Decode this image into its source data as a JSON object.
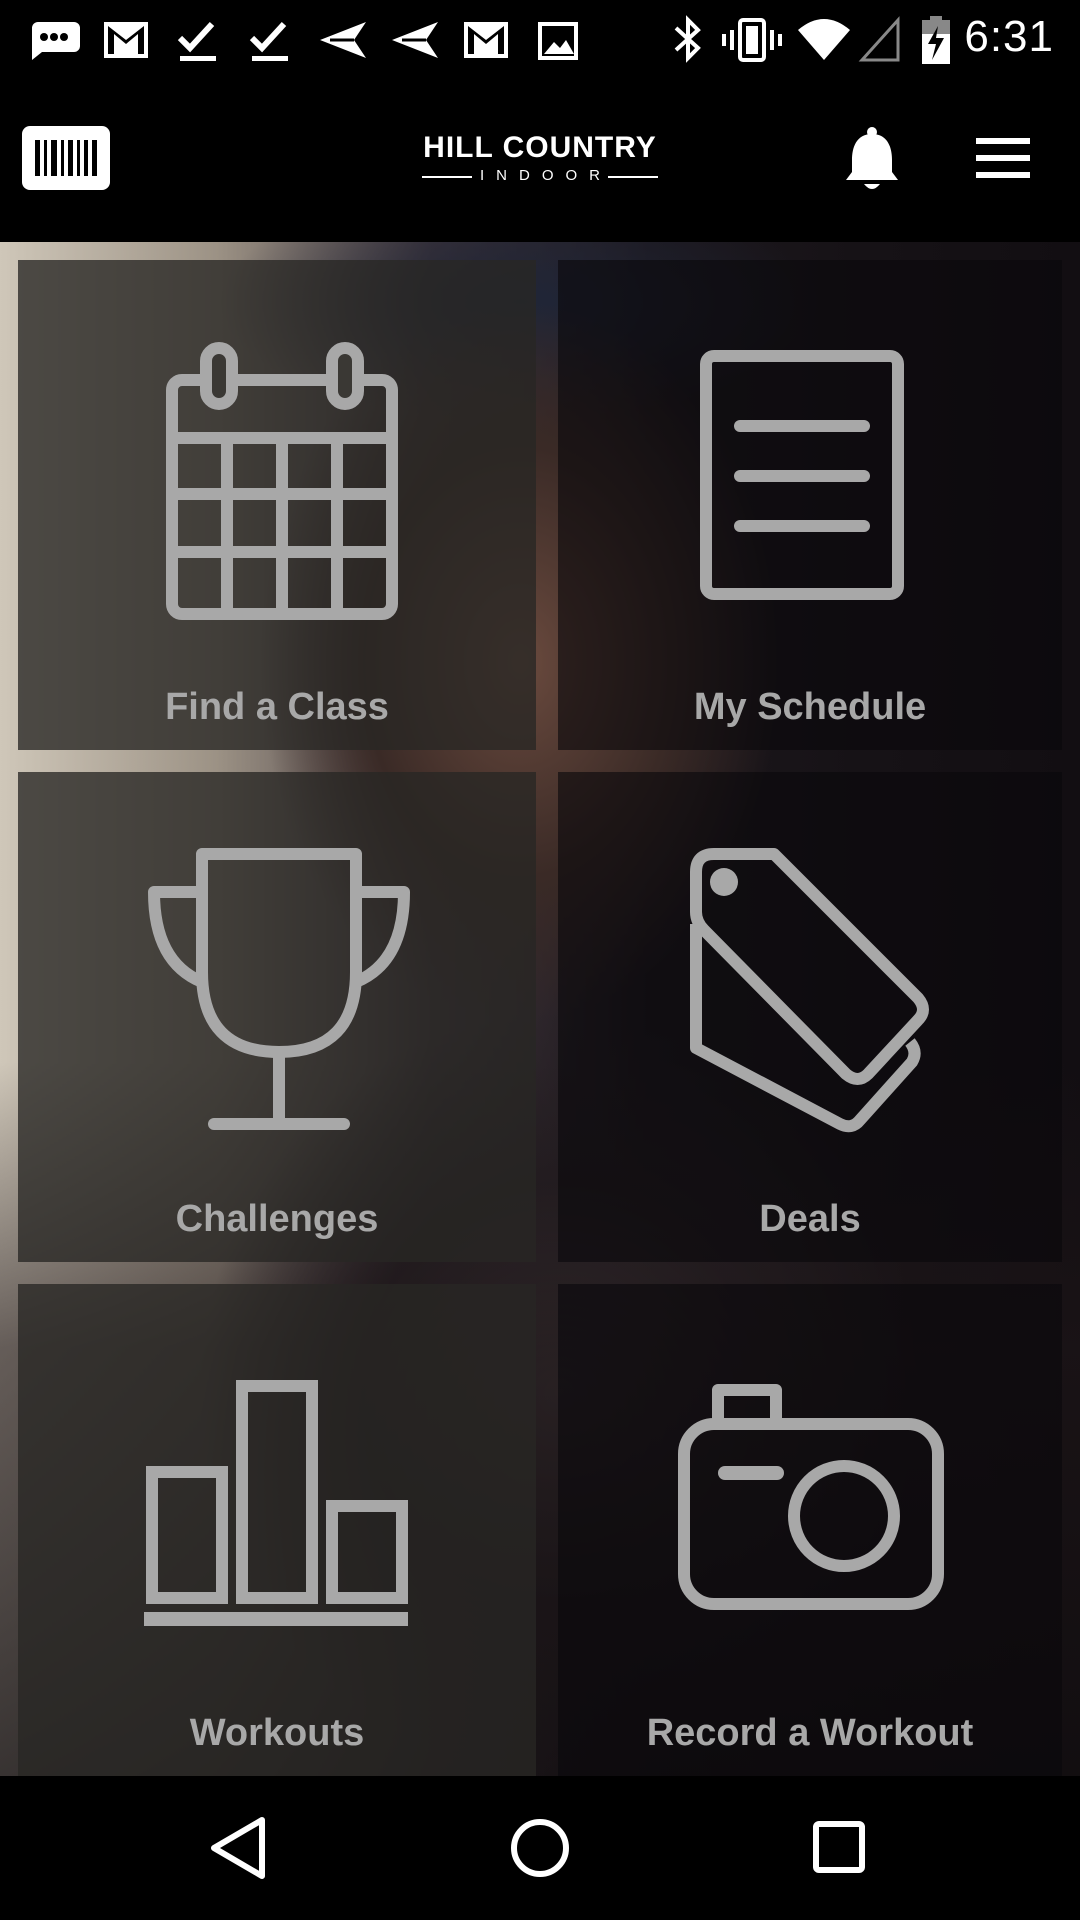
{
  "status_bar": {
    "time": "6:31",
    "left_icons": [
      "chat-notification-icon",
      "gmail-icon",
      "check-icon",
      "check-icon",
      "send-icon",
      "send-icon",
      "gmail-icon",
      "image-icon"
    ],
    "right_icons": [
      "bluetooth-icon",
      "vibrate-icon",
      "wifi-icon",
      "signal-icon",
      "battery-charging-icon"
    ]
  },
  "app_bar": {
    "logo_main": "HILL COUNTRY",
    "logo_sub": "INDOOR",
    "barcode_icon": "barcode-icon",
    "bell_icon": "bell-icon",
    "menu_icon": "hamburger-menu-icon"
  },
  "tiles": [
    {
      "label": "Find a Class",
      "icon": "calendar-icon"
    },
    {
      "label": "My Schedule",
      "icon": "document-icon"
    },
    {
      "label": "Challenges",
      "icon": "trophy-icon"
    },
    {
      "label": "Deals",
      "icon": "price-tag-icon"
    },
    {
      "label": "Workouts",
      "icon": "bar-chart-icon"
    },
    {
      "label": "Record a Workout",
      "icon": "camera-icon"
    }
  ],
  "nav_bar": {
    "back_icon": "back-icon",
    "home_icon": "home-icon",
    "recents_icon": "recents-icon"
  },
  "colors": {
    "tile_label": "#a8a8a8",
    "icon_stroke": "#a8a8a8",
    "bar_background": "#000000"
  }
}
